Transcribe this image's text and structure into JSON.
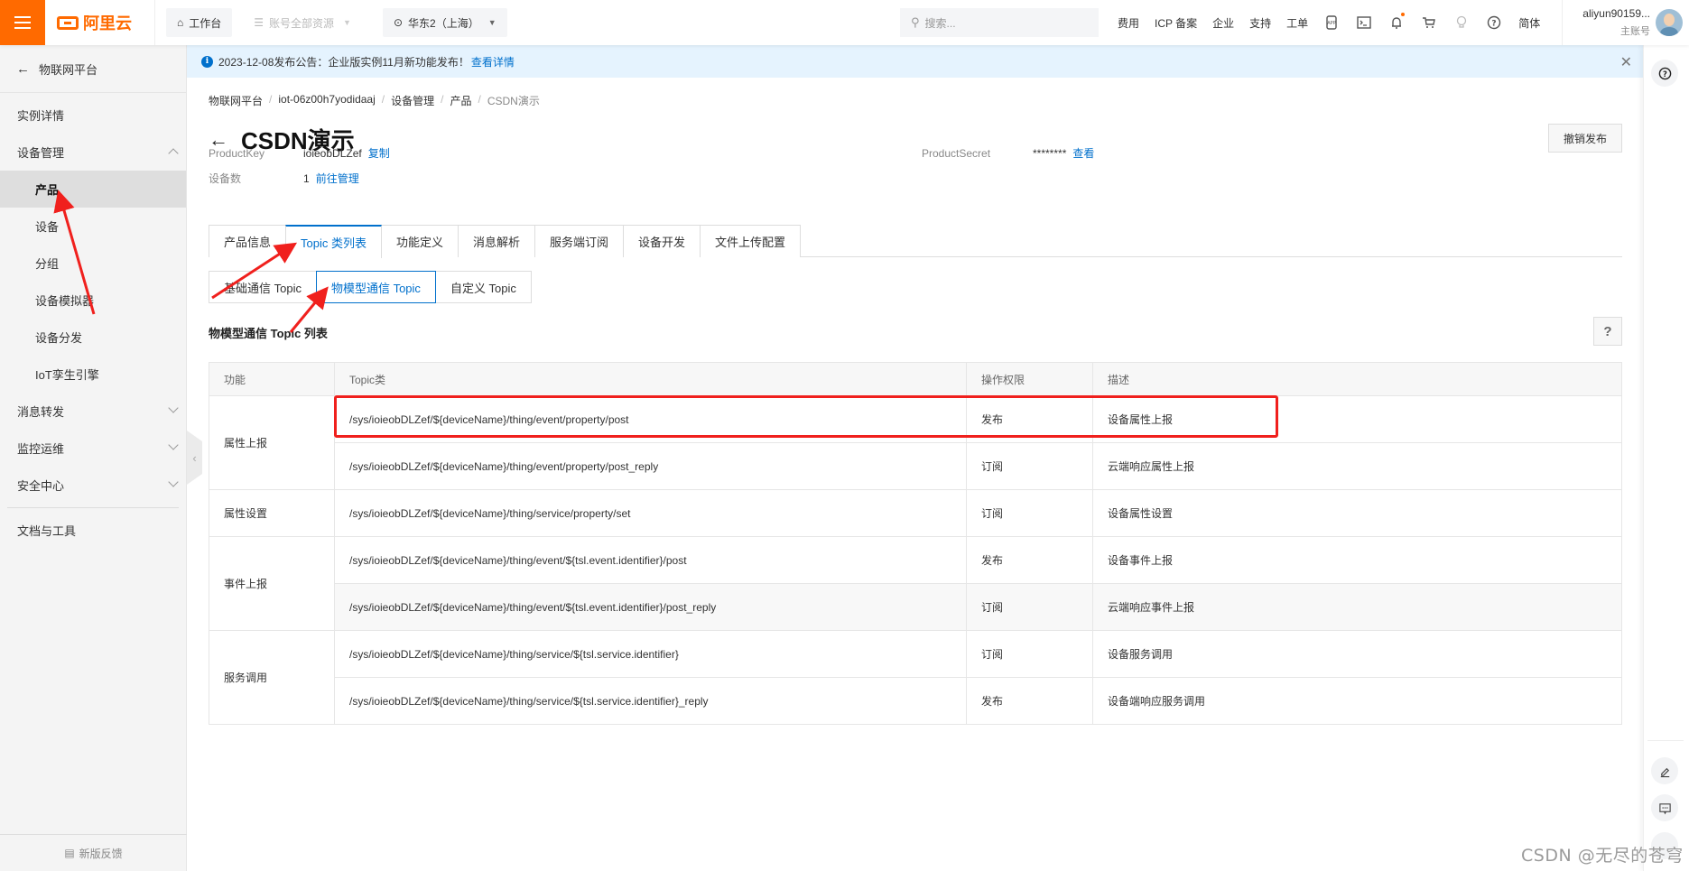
{
  "topbar": {
    "brand": "阿里云",
    "workbench": "工作台",
    "resources": "账号全部资源",
    "region": "华东2（上海）",
    "search_placeholder": "搜索...",
    "links": [
      "费用",
      "ICP 备案",
      "企业",
      "支持",
      "工单"
    ],
    "icons": [
      "app-icon",
      "terminal-icon",
      "bell-icon",
      "cart-icon",
      "lightbulb-icon",
      "help-icon"
    ],
    "language": "简体",
    "user_name": "aliyun90159...",
    "user_role": "主账号",
    "accent_color": "#ff6a00"
  },
  "sidebar": {
    "back_label": "物联网平台",
    "items": [
      {
        "label": "实例详情",
        "level": 0
      },
      {
        "label": "设备管理",
        "level": 0,
        "expanded": true
      },
      {
        "label": "产品",
        "level": 1,
        "active": true
      },
      {
        "label": "设备",
        "level": 1
      },
      {
        "label": "分组",
        "level": 1
      },
      {
        "label": "设备模拟器",
        "level": 1
      },
      {
        "label": "设备分发",
        "level": 1
      },
      {
        "label": "IoT孪生引擎",
        "level": 1
      },
      {
        "label": "消息转发",
        "level": 0,
        "expanded": false
      },
      {
        "label": "监控运维",
        "level": 0,
        "expanded": false
      },
      {
        "label": "安全中心",
        "level": 0,
        "expanded": false
      },
      {
        "label": "文档与工具",
        "level": 0
      }
    ],
    "feedback": "新版反馈"
  },
  "notice": {
    "text": "2023-12-08发布公告：企业版实例11月新功能发布！",
    "link": "查看详情"
  },
  "breadcrumb": [
    "物联网平台",
    "iot-06z00h7yodidaaj",
    "设备管理",
    "产品",
    "CSDN演示"
  ],
  "page": {
    "title": "CSDN演示",
    "unpublish_button": "撤销发布",
    "product_key_label": "ProductKey",
    "product_key": "ioieobDLZef",
    "copy_link": "复制",
    "product_secret_label": "ProductSecret",
    "product_secret": "********",
    "view_link": "查看",
    "device_count_label": "设备数",
    "device_count": "1",
    "manage_link": "前往管理"
  },
  "tabs": [
    {
      "label": "产品信息"
    },
    {
      "label": "Topic 类列表",
      "active": true
    },
    {
      "label": "功能定义"
    },
    {
      "label": "消息解析"
    },
    {
      "label": "服务端订阅"
    },
    {
      "label": "设备开发"
    },
    {
      "label": "文件上传配置"
    }
  ],
  "subtabs": [
    {
      "label": "基础通信 Topic"
    },
    {
      "label": "物模型通信 Topic",
      "active": true
    },
    {
      "label": "自定义 Topic"
    }
  ],
  "section_title": "物模型通信 Topic 列表",
  "table": {
    "headers": [
      "功能",
      "Topic类",
      "操作权限",
      "描述"
    ],
    "groups": [
      {
        "function": "属性上报",
        "rows": [
          {
            "topic": "/sys/ioieobDLZef/${deviceName}/thing/event/property/post",
            "permission": "发布",
            "description": "设备属性上报",
            "highlighted": true
          },
          {
            "topic": "/sys/ioieobDLZef/${deviceName}/thing/event/property/post_reply",
            "permission": "订阅",
            "description": "云端响应属性上报"
          }
        ]
      },
      {
        "function": "属性设置",
        "rows": [
          {
            "topic": "/sys/ioieobDLZef/${deviceName}/thing/service/property/set",
            "permission": "订阅",
            "description": "设备属性设置"
          }
        ]
      },
      {
        "function": "事件上报",
        "rows": [
          {
            "topic": "/sys/ioieobDLZef/${deviceName}/thing/event/${tsl.event.identifier}/post",
            "permission": "发布",
            "description": "设备事件上报"
          },
          {
            "topic": "/sys/ioieobDLZef/${deviceName}/thing/event/${tsl.event.identifier}/post_reply",
            "permission": "订阅",
            "description": "云端响应事件上报",
            "hover": true
          }
        ]
      },
      {
        "function": "服务调用",
        "rows": [
          {
            "topic": "/sys/ioieobDLZef/${deviceName}/thing/service/${tsl.service.identifier}",
            "permission": "订阅",
            "description": "设备服务调用"
          },
          {
            "topic": "/sys/ioieobDLZef/${deviceName}/thing/service/${tsl.service.identifier}_reply",
            "permission": "发布",
            "description": "设备端响应服务调用"
          }
        ]
      }
    ]
  },
  "watermark": "CSDN @无尽的苍穹"
}
